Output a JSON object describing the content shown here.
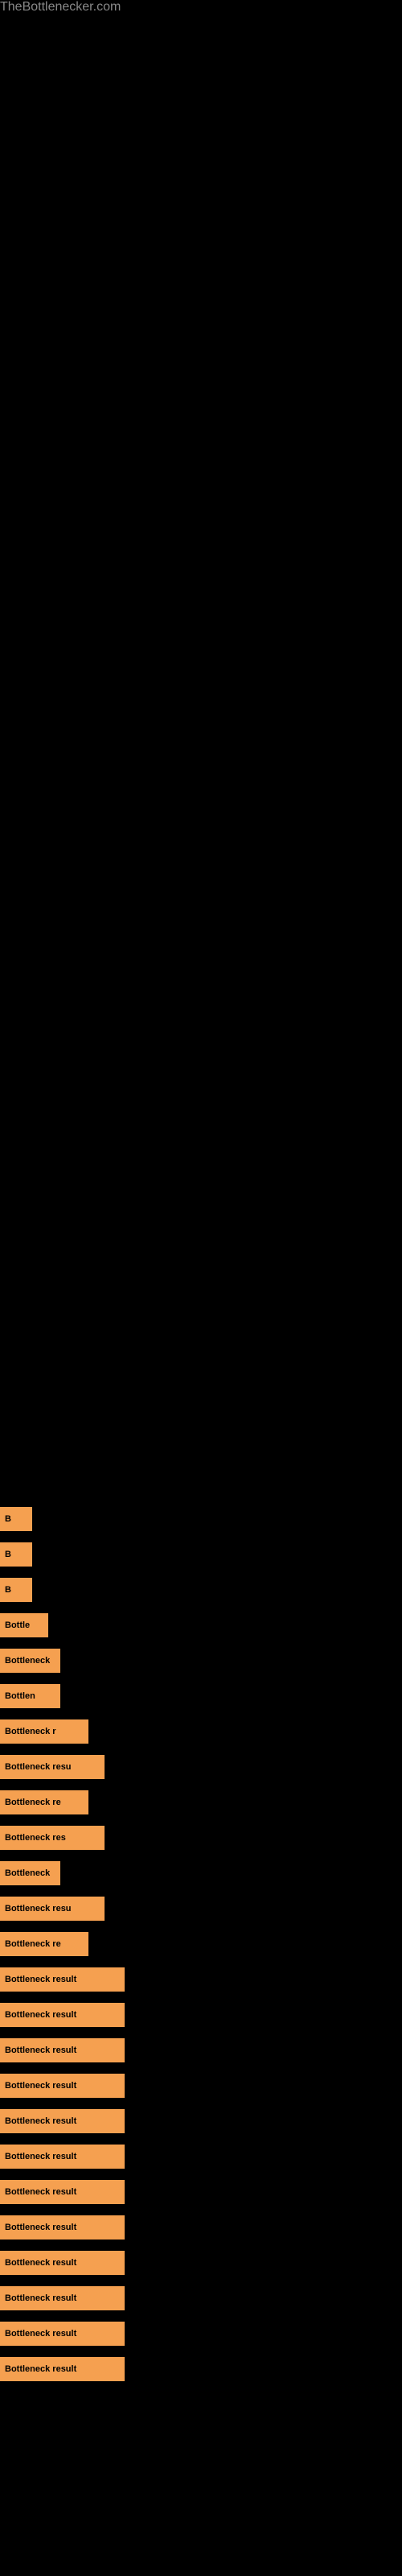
{
  "site": {
    "title": "TheBottlenecker.com"
  },
  "bars": [
    {
      "id": 1,
      "label": "B",
      "widthClass": "bar-xs"
    },
    {
      "id": 2,
      "label": "B",
      "widthClass": "bar-xs"
    },
    {
      "id": 3,
      "label": "B",
      "widthClass": "bar-xs"
    },
    {
      "id": 4,
      "label": "Bottle",
      "widthClass": "bar-s"
    },
    {
      "id": 5,
      "label": "Bottleneck",
      "widthClass": "bar-sm"
    },
    {
      "id": 6,
      "label": "Bottlen",
      "widthClass": "bar-sm"
    },
    {
      "id": 7,
      "label": "Bottleneck r",
      "widthClass": "bar-ml"
    },
    {
      "id": 8,
      "label": "Bottleneck resu",
      "widthClass": "bar-l"
    },
    {
      "id": 9,
      "label": "Bottleneck re",
      "widthClass": "bar-ml"
    },
    {
      "id": 10,
      "label": "Bottleneck res",
      "widthClass": "bar-l"
    },
    {
      "id": 11,
      "label": "Bottleneck",
      "widthClass": "bar-sm"
    },
    {
      "id": 12,
      "label": "Bottleneck resu",
      "widthClass": "bar-l"
    },
    {
      "id": 13,
      "label": "Bottleneck re",
      "widthClass": "bar-ml"
    },
    {
      "id": 14,
      "label": "Bottleneck result",
      "widthClass": "bar-xl"
    },
    {
      "id": 15,
      "label": "Bottleneck result",
      "widthClass": "bar-xl"
    },
    {
      "id": 16,
      "label": "Bottleneck result",
      "widthClass": "bar-xl"
    },
    {
      "id": 17,
      "label": "Bottleneck result",
      "widthClass": "bar-xl"
    },
    {
      "id": 18,
      "label": "Bottleneck result",
      "widthClass": "bar-xl"
    },
    {
      "id": 19,
      "label": "Bottleneck result",
      "widthClass": "bar-xl"
    },
    {
      "id": 20,
      "label": "Bottleneck result",
      "widthClass": "bar-xl"
    },
    {
      "id": 21,
      "label": "Bottleneck result",
      "widthClass": "bar-xl"
    },
    {
      "id": 22,
      "label": "Bottleneck result",
      "widthClass": "bar-xl"
    },
    {
      "id": 23,
      "label": "Bottleneck result",
      "widthClass": "bar-xl"
    },
    {
      "id": 24,
      "label": "Bottleneck result",
      "widthClass": "bar-xl"
    },
    {
      "id": 25,
      "label": "Bottleneck result",
      "widthClass": "bar-xl"
    }
  ]
}
